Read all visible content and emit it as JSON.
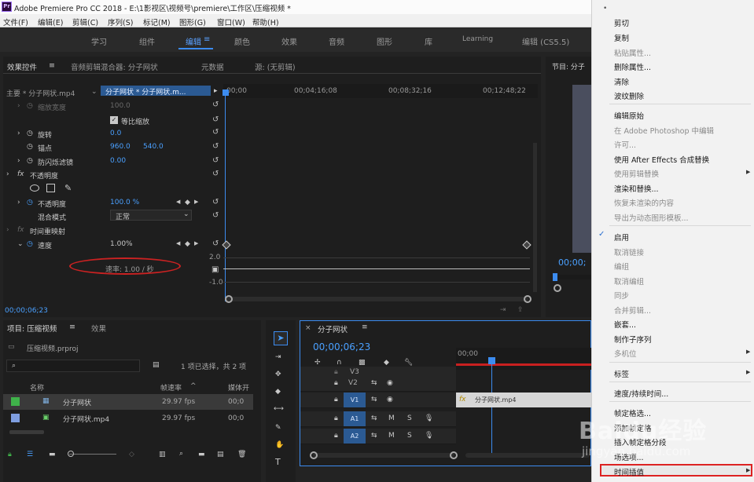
{
  "titlebar": {
    "title": "Adobe Premiere Pro CC 2018 - E:\\1影视区\\视频号\\premiere\\工作区\\压缩视频 *"
  },
  "menu": [
    "文件(F)",
    "编辑(E)",
    "剪辑(C)",
    "序列(S)",
    "标记(M)",
    "图形(G)",
    "窗口(W)",
    "帮助(H)"
  ],
  "workspaces": [
    "学习",
    "组件",
    "编辑",
    "颜色",
    "效果",
    "音频",
    "图形",
    "库",
    "Learning",
    "编辑 (CS5.5)"
  ],
  "effects": {
    "tabs": [
      "效果控件",
      "音频剪辑混合器: 分子网状",
      "元数据",
      "源: (无剪辑)"
    ],
    "master": "主要 * 分子网状.mp4",
    "clip": "分子网状 * 分子网状.m...",
    "ruler": [
      "00;00",
      "00;04;16;08",
      "00;08;32;16",
      "00;12;48;22"
    ],
    "rows": {
      "scale_width": "缩放宽度",
      "scale_width_val": "100.0",
      "uniform": "等比缩放",
      "rotation": "旋转",
      "rotation_val": "0.0",
      "anchor": "锚点",
      "anchor_x": "960.0",
      "anchor_y": "540.0",
      "flicker": "防闪烁滤镜",
      "flicker_val": "0.00",
      "opacity_group": "不透明度",
      "opacity": "不透明度",
      "opacity_val": "100.0 %",
      "blend": "混合模式",
      "blend_val": "正常",
      "time_remap": "时间重映射",
      "speed": "速度",
      "speed_val": "1.00%",
      "graph_hi": "2.0",
      "graph_lo": "-1.0",
      "rate": "速率: 1.00 / 秒"
    },
    "timecode": "00;00;06;23"
  },
  "program": {
    "title": "节目: 分子",
    "timecode": "00;00;"
  },
  "project": {
    "tabs": [
      "项目: 压缩视频",
      "效果"
    ],
    "file": "压缩视频.prproj",
    "selection": "1 项已选择，共 2 项",
    "cols": [
      "名称",
      "帧速率",
      "媒体开"
    ],
    "items": [
      {
        "name": "分子网状",
        "fps": "29.97 fps",
        "start": "00;0",
        "color": "#3fb24a"
      },
      {
        "name": "分子网状.mp4",
        "fps": "29.97 fps",
        "start": "00;0",
        "color": "#7f9ee0"
      }
    ]
  },
  "timeline": {
    "title": "分子网状",
    "timecode": "00;00;06;23",
    "ruler": "00;00",
    "tracks": [
      {
        "name": "V3"
      },
      {
        "name": "V2"
      },
      {
        "name": "V1",
        "target": "V1"
      },
      {
        "name": "A1",
        "target": "A1"
      },
      {
        "name": "A2",
        "target": "A2"
      }
    ],
    "track_btns": [
      "M",
      "S"
    ],
    "clip": "分子网状.mp4",
    "fx": "fx"
  },
  "context_menu": [
    {
      "label": "剪切",
      "enabled": true
    },
    {
      "label": "复制",
      "enabled": true
    },
    {
      "label": "粘贴属性...",
      "enabled": false
    },
    {
      "label": "删除属性...",
      "enabled": true
    },
    {
      "label": "清除",
      "enabled": true
    },
    {
      "label": "波纹删除",
      "enabled": true
    },
    {
      "sep": true
    },
    {
      "label": "编辑原始",
      "enabled": true
    },
    {
      "label": "在 Adobe Photoshop 中编辑",
      "enabled": false
    },
    {
      "label": "许可...",
      "enabled": false
    },
    {
      "label": "使用 After Effects 合成替换",
      "enabled": true
    },
    {
      "label": "使用剪辑替换",
      "enabled": false,
      "sub": true
    },
    {
      "label": "渲染和替换...",
      "enabled": true
    },
    {
      "label": "恢复未渲染的内容",
      "enabled": false
    },
    {
      "label": "导出为动态图形模板...",
      "enabled": false
    },
    {
      "sep": true
    },
    {
      "label": "启用",
      "enabled": true,
      "checked": true
    },
    {
      "label": "取消链接",
      "enabled": false
    },
    {
      "label": "编组",
      "enabled": false
    },
    {
      "label": "取消编组",
      "enabled": false
    },
    {
      "label": "同步",
      "enabled": false
    },
    {
      "label": "合并剪辑...",
      "enabled": false
    },
    {
      "label": "嵌套...",
      "enabled": true
    },
    {
      "label": "制作子序列",
      "enabled": true
    },
    {
      "label": "多机位",
      "enabled": false,
      "sub": true
    },
    {
      "sep": true
    },
    {
      "label": "标签",
      "enabled": true,
      "sub": true
    },
    {
      "sep": true
    },
    {
      "label": "速度/持续时间...",
      "enabled": true
    },
    {
      "sep": true
    },
    {
      "label": "帧定格选...",
      "enabled": true
    },
    {
      "label": "添加帧定格",
      "enabled": true
    },
    {
      "label": "插入帧定格分段",
      "enabled": true
    },
    {
      "label": "场选项...",
      "enabled": true
    },
    {
      "label": "时间插值",
      "enabled": true,
      "sub": true
    }
  ],
  "watermark": {
    "brand": "Baidu经验",
    "url": "jingyan.baidu.com"
  },
  "colors": {
    "accent": "#3c8cf0",
    "playhead": "#3c8cf0",
    "highlight_red": "#cc2222"
  }
}
